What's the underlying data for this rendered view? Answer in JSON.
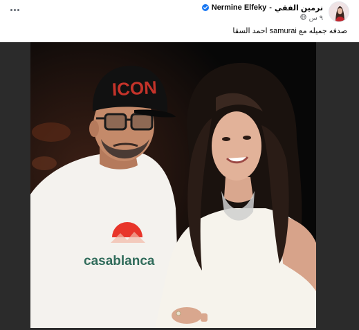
{
  "post": {
    "author_arabic": "نرمين الفقي",
    "author_separator": "-",
    "author_latin": "Nermine Elfeky",
    "time": "٩ س",
    "caption": "صدفه جميله مع samurai احمد السقا",
    "photo": {
      "cap_text": "ICON",
      "shirt_brand": "casablanca"
    }
  },
  "colors": {
    "verified": "#1877f2",
    "secondary_text": "#65676b",
    "shirt_logo_red": "#e8352a",
    "shirt_text_green": "#2f6b5a"
  },
  "icons": {
    "more": "more-horizontal-icon",
    "verified": "verified-badge-icon",
    "audience": "globe-icon"
  }
}
